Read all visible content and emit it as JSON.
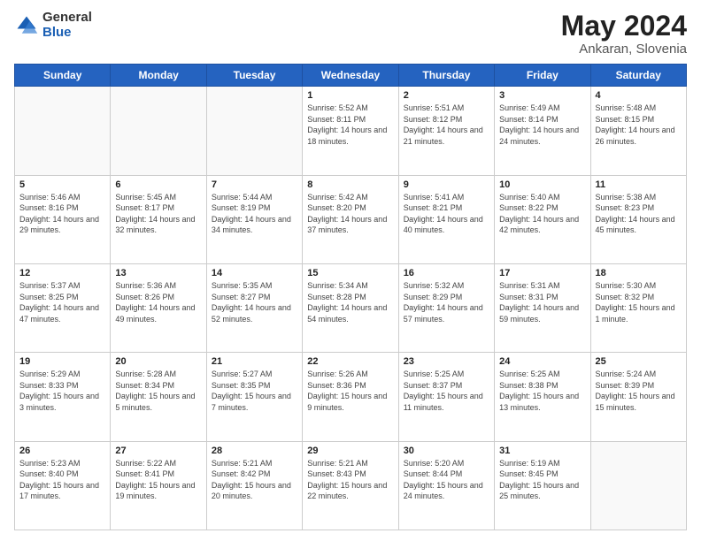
{
  "header": {
    "logo": {
      "general": "General",
      "blue": "Blue"
    },
    "title": "May 2024",
    "location": "Ankaran, Slovenia"
  },
  "weekdays": [
    "Sunday",
    "Monday",
    "Tuesday",
    "Wednesday",
    "Thursday",
    "Friday",
    "Saturday"
  ],
  "weeks": [
    [
      {
        "day": "",
        "sunrise": "",
        "sunset": "",
        "daylight": ""
      },
      {
        "day": "",
        "sunrise": "",
        "sunset": "",
        "daylight": ""
      },
      {
        "day": "",
        "sunrise": "",
        "sunset": "",
        "daylight": ""
      },
      {
        "day": "1",
        "sunrise": "Sunrise: 5:52 AM",
        "sunset": "Sunset: 8:11 PM",
        "daylight": "Daylight: 14 hours and 18 minutes."
      },
      {
        "day": "2",
        "sunrise": "Sunrise: 5:51 AM",
        "sunset": "Sunset: 8:12 PM",
        "daylight": "Daylight: 14 hours and 21 minutes."
      },
      {
        "day": "3",
        "sunrise": "Sunrise: 5:49 AM",
        "sunset": "Sunset: 8:14 PM",
        "daylight": "Daylight: 14 hours and 24 minutes."
      },
      {
        "day": "4",
        "sunrise": "Sunrise: 5:48 AM",
        "sunset": "Sunset: 8:15 PM",
        "daylight": "Daylight: 14 hours and 26 minutes."
      }
    ],
    [
      {
        "day": "5",
        "sunrise": "Sunrise: 5:46 AM",
        "sunset": "Sunset: 8:16 PM",
        "daylight": "Daylight: 14 hours and 29 minutes."
      },
      {
        "day": "6",
        "sunrise": "Sunrise: 5:45 AM",
        "sunset": "Sunset: 8:17 PM",
        "daylight": "Daylight: 14 hours and 32 minutes."
      },
      {
        "day": "7",
        "sunrise": "Sunrise: 5:44 AM",
        "sunset": "Sunset: 8:19 PM",
        "daylight": "Daylight: 14 hours and 34 minutes."
      },
      {
        "day": "8",
        "sunrise": "Sunrise: 5:42 AM",
        "sunset": "Sunset: 8:20 PM",
        "daylight": "Daylight: 14 hours and 37 minutes."
      },
      {
        "day": "9",
        "sunrise": "Sunrise: 5:41 AM",
        "sunset": "Sunset: 8:21 PM",
        "daylight": "Daylight: 14 hours and 40 minutes."
      },
      {
        "day": "10",
        "sunrise": "Sunrise: 5:40 AM",
        "sunset": "Sunset: 8:22 PM",
        "daylight": "Daylight: 14 hours and 42 minutes."
      },
      {
        "day": "11",
        "sunrise": "Sunrise: 5:38 AM",
        "sunset": "Sunset: 8:23 PM",
        "daylight": "Daylight: 14 hours and 45 minutes."
      }
    ],
    [
      {
        "day": "12",
        "sunrise": "Sunrise: 5:37 AM",
        "sunset": "Sunset: 8:25 PM",
        "daylight": "Daylight: 14 hours and 47 minutes."
      },
      {
        "day": "13",
        "sunrise": "Sunrise: 5:36 AM",
        "sunset": "Sunset: 8:26 PM",
        "daylight": "Daylight: 14 hours and 49 minutes."
      },
      {
        "day": "14",
        "sunrise": "Sunrise: 5:35 AM",
        "sunset": "Sunset: 8:27 PM",
        "daylight": "Daylight: 14 hours and 52 minutes."
      },
      {
        "day": "15",
        "sunrise": "Sunrise: 5:34 AM",
        "sunset": "Sunset: 8:28 PM",
        "daylight": "Daylight: 14 hours and 54 minutes."
      },
      {
        "day": "16",
        "sunrise": "Sunrise: 5:32 AM",
        "sunset": "Sunset: 8:29 PM",
        "daylight": "Daylight: 14 hours and 57 minutes."
      },
      {
        "day": "17",
        "sunrise": "Sunrise: 5:31 AM",
        "sunset": "Sunset: 8:31 PM",
        "daylight": "Daylight: 14 hours and 59 minutes."
      },
      {
        "day": "18",
        "sunrise": "Sunrise: 5:30 AM",
        "sunset": "Sunset: 8:32 PM",
        "daylight": "Daylight: 15 hours and 1 minute."
      }
    ],
    [
      {
        "day": "19",
        "sunrise": "Sunrise: 5:29 AM",
        "sunset": "Sunset: 8:33 PM",
        "daylight": "Daylight: 15 hours and 3 minutes."
      },
      {
        "day": "20",
        "sunrise": "Sunrise: 5:28 AM",
        "sunset": "Sunset: 8:34 PM",
        "daylight": "Daylight: 15 hours and 5 minutes."
      },
      {
        "day": "21",
        "sunrise": "Sunrise: 5:27 AM",
        "sunset": "Sunset: 8:35 PM",
        "daylight": "Daylight: 15 hours and 7 minutes."
      },
      {
        "day": "22",
        "sunrise": "Sunrise: 5:26 AM",
        "sunset": "Sunset: 8:36 PM",
        "daylight": "Daylight: 15 hours and 9 minutes."
      },
      {
        "day": "23",
        "sunrise": "Sunrise: 5:25 AM",
        "sunset": "Sunset: 8:37 PM",
        "daylight": "Daylight: 15 hours and 11 minutes."
      },
      {
        "day": "24",
        "sunrise": "Sunrise: 5:25 AM",
        "sunset": "Sunset: 8:38 PM",
        "daylight": "Daylight: 15 hours and 13 minutes."
      },
      {
        "day": "25",
        "sunrise": "Sunrise: 5:24 AM",
        "sunset": "Sunset: 8:39 PM",
        "daylight": "Daylight: 15 hours and 15 minutes."
      }
    ],
    [
      {
        "day": "26",
        "sunrise": "Sunrise: 5:23 AM",
        "sunset": "Sunset: 8:40 PM",
        "daylight": "Daylight: 15 hours and 17 minutes."
      },
      {
        "day": "27",
        "sunrise": "Sunrise: 5:22 AM",
        "sunset": "Sunset: 8:41 PM",
        "daylight": "Daylight: 15 hours and 19 minutes."
      },
      {
        "day": "28",
        "sunrise": "Sunrise: 5:21 AM",
        "sunset": "Sunset: 8:42 PM",
        "daylight": "Daylight: 15 hours and 20 minutes."
      },
      {
        "day": "29",
        "sunrise": "Sunrise: 5:21 AM",
        "sunset": "Sunset: 8:43 PM",
        "daylight": "Daylight: 15 hours and 22 minutes."
      },
      {
        "day": "30",
        "sunrise": "Sunrise: 5:20 AM",
        "sunset": "Sunset: 8:44 PM",
        "daylight": "Daylight: 15 hours and 24 minutes."
      },
      {
        "day": "31",
        "sunrise": "Sunrise: 5:19 AM",
        "sunset": "Sunset: 8:45 PM",
        "daylight": "Daylight: 15 hours and 25 minutes."
      },
      {
        "day": "",
        "sunrise": "",
        "sunset": "",
        "daylight": ""
      }
    ]
  ]
}
